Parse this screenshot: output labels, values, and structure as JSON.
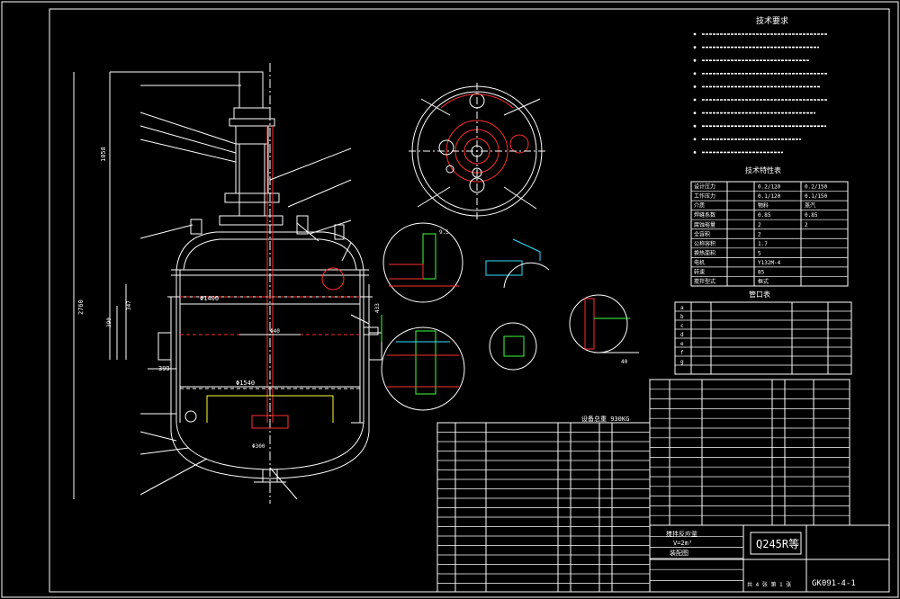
{
  "drawing": {
    "code": "GK091-4-1",
    "material": "Q245R等",
    "total_weight": "设备总重 930KG"
  },
  "colors": {
    "background": "#000000",
    "line": "#ffffff",
    "red": "#ff3030",
    "green": "#40ff40",
    "cyan": "#30e0ff",
    "yellow": "#ffff40",
    "blue": "#4060ff"
  },
  "titles": {
    "tech_requirements": "技术要求",
    "tech_characteristics": "技术特性表",
    "nozzle_table": "管口表"
  },
  "dimensions": {
    "overall_height": "2760",
    "top_height": "1058",
    "shell_dia": "Φ1400",
    "jacket_dia": "Φ1540",
    "shaft_dia": "Φ40",
    "d347": "347",
    "d399": "399",
    "d390": "390",
    "d433": "433",
    "d80": "80",
    "d95": "9.5",
    "d40": "40",
    "d300": "Φ300"
  },
  "spec_rows": [
    [
      "设计压力",
      "0.2/120",
      "0.2/150"
    ],
    [
      "工作压力",
      "0.1/120",
      "0.1/150"
    ],
    [
      "介质",
      "物料",
      "蒸汽"
    ],
    [
      "焊缝系数",
      "0.85",
      "0.85"
    ],
    [
      "腐蚀裕量",
      "2",
      "2"
    ],
    [
      "全容积",
      "2",
      ""
    ],
    [
      "公称容积",
      "1.7",
      ""
    ],
    [
      "换热面积",
      "5",
      ""
    ],
    [
      "电机",
      "Y132M-4",
      ""
    ],
    [
      "转速",
      "85",
      ""
    ],
    [
      "搅拌型式",
      "框式",
      ""
    ]
  ],
  "nozzle_labels": [
    "a",
    "b",
    "c",
    "d",
    "e",
    "f",
    "g"
  ],
  "title_block": {
    "name_line1": "搅拌反应釜",
    "name_line2": "V=2m³",
    "name_line3": "装配图",
    "scale_line": "共 4 张  第 1 张"
  }
}
